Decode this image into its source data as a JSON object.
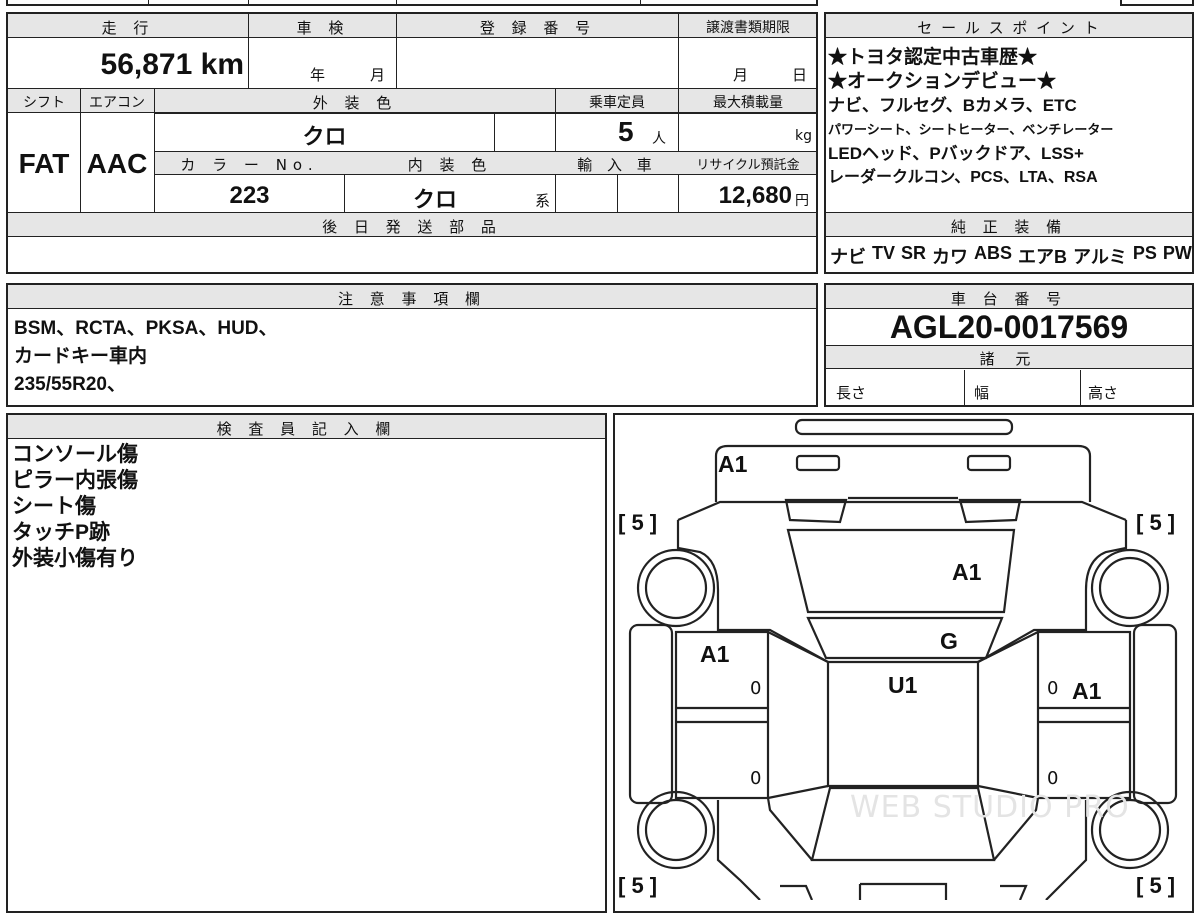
{
  "spec": {
    "mileage_label": "走 行",
    "shaken_label": "車 検",
    "registration_label": "登 録 番 号",
    "transfer_doc_label": "譲渡書類期限",
    "mileage_value": "56,871 km",
    "year_unit": "年",
    "month_unit": "月",
    "transfer_month_unit": "月",
    "transfer_day_unit": "日",
    "shift_label": "シフト",
    "aircon_label": "エアコン",
    "exterior_color_label": "外 装 色",
    "capacity_label": "乗車定員",
    "max_load_label": "最大積載量",
    "shift_value": "FAT",
    "aircon_value": "AAC",
    "exterior_color_value": "クロ",
    "capacity_value": "5",
    "capacity_unit": "人",
    "max_load_unit": "kg",
    "color_no_label": "カ ラ ー No.",
    "interior_color_label": "内 装 色",
    "import_label": "輸 入 車",
    "recycle_label": "リサイクル預託金",
    "color_no_value": "223",
    "interior_color_value": "クロ",
    "interior_color_suffix": "系",
    "recycle_value": "12,680",
    "recycle_unit": "円",
    "later_parts_label": "後 日 発 送 部 品"
  },
  "sales": {
    "label": "セ ー ル ス ポ イ ン ト",
    "lines": [
      "★トヨタ認定中古車歴★",
      "★オークションデビュー★",
      "ナビ、フルセグ、Bカメラ、ETC",
      "パワーシート、シートヒーター、ベンチレーター",
      "LEDヘッド、Pバックドア、LSS+",
      "レーダークルコン、PCS、LTA、RSA"
    ]
  },
  "equipment": {
    "label": "純 正 装 備",
    "items": [
      "ナビ",
      "TV",
      "SR",
      "カワ",
      "ABS",
      "エアB",
      "アルミ",
      "PS",
      "PW"
    ]
  },
  "notes": {
    "label": "注 意 事 項 欄",
    "lines": [
      "BSM、RCTA、PKSA、HUD、",
      "カードキー車内",
      "235/55R20、"
    ]
  },
  "chassis": {
    "label": "車 台 番 号",
    "value": "AGL20-0017569",
    "specs_label": "諸 元",
    "length_label": "長さ",
    "width_label": "幅",
    "height_label": "高さ"
  },
  "inspector": {
    "label": "検 査 員 記 入 欄",
    "lines": [
      "コンソール傷",
      "ピラー内張傷",
      "シート傷",
      "タッチP跡",
      "外装小傷有り"
    ]
  },
  "diagram": {
    "tire_fl": "[ 5 ]",
    "tire_fr": "[ 5 ]",
    "tire_rl": "[ 5 ]",
    "tire_rr": "[ 5 ]",
    "marks": {
      "front_bumper": "A1",
      "hood": "A1",
      "windshield": "G",
      "roof": "U1",
      "left_front_door": "A1",
      "right_front_door": "A1",
      "zero_lf": "0",
      "zero_rf": "0",
      "zero_lr": "0",
      "zero_rr": "0"
    },
    "watermark": "WEB STUDIO PRO"
  }
}
